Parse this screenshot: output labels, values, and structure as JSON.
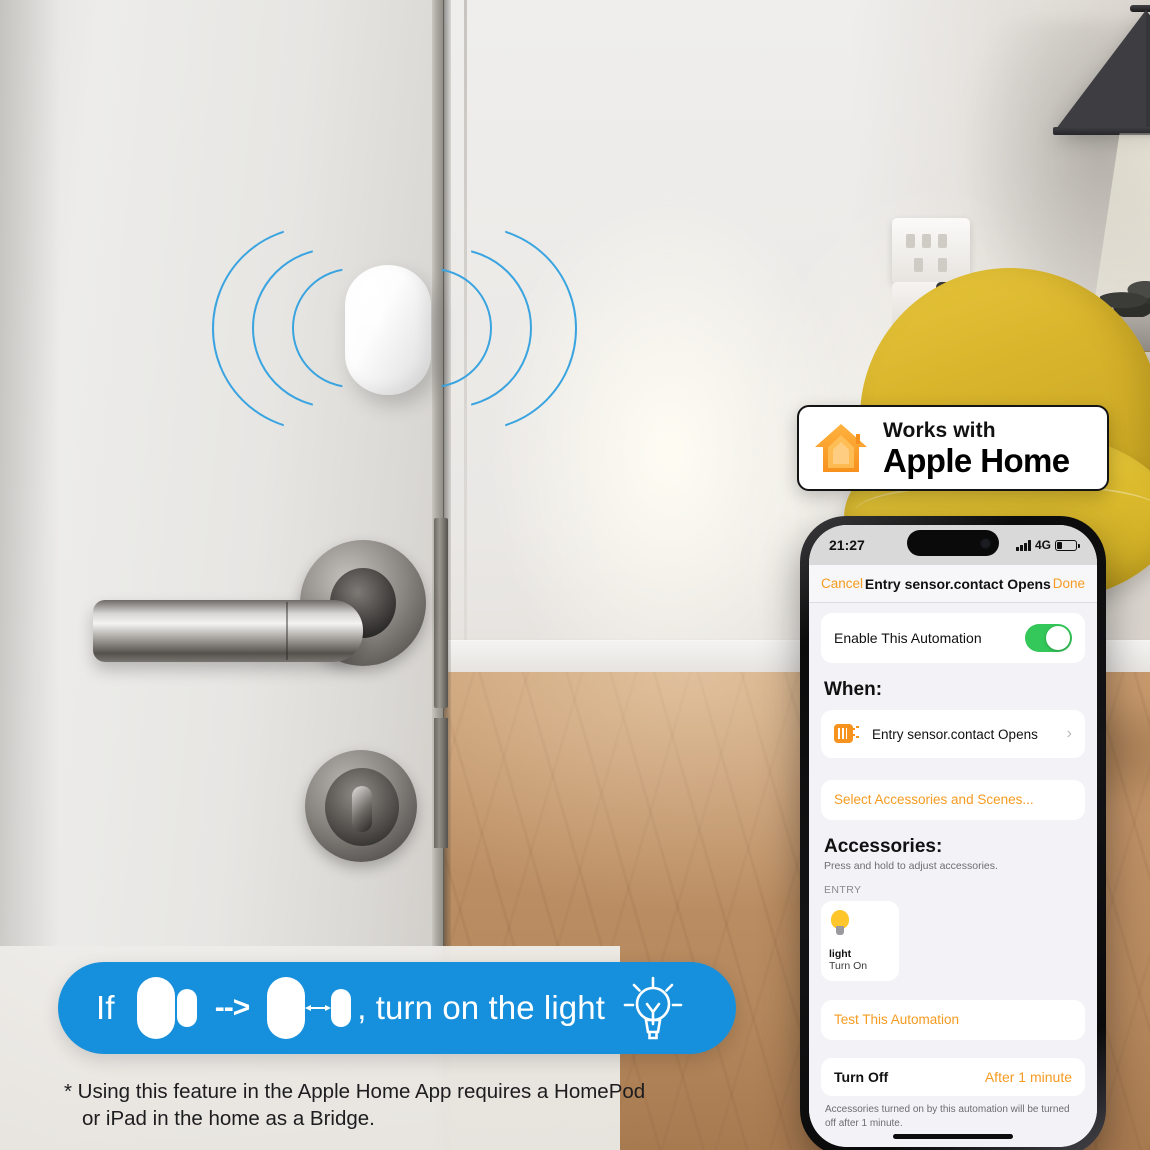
{
  "badge": {
    "icon": "apple-home-house-icon",
    "line1": "Works with",
    "line2": "Apple Home"
  },
  "phone": {
    "status_bar": {
      "time": "21:27",
      "signal_icon": "cellular-bars-icon",
      "network": "4G",
      "battery_icon": "battery-icon"
    },
    "nav": {
      "cancel": "Cancel",
      "title": "Entry sensor.contact Opens",
      "done": "Done"
    },
    "enable_row": {
      "label": "Enable This Automation",
      "toggle_state": "on",
      "toggle_color": "#34C759"
    },
    "when": {
      "heading": "When:",
      "trigger_icon": "contact-sensor-icon",
      "trigger_label": "Entry sensor.contact Opens",
      "chevron": "›"
    },
    "select_accessories_link": "Select Accessories and Scenes...",
    "accessories": {
      "heading": "Accessories:",
      "hint": "Press and hold to adjust accessories.",
      "group": "ENTRY",
      "tiles": [
        {
          "icon": "light-bulb-icon",
          "name": "light",
          "state": "Turn On"
        }
      ]
    },
    "test_link": "Test This Automation",
    "turn_off": {
      "label": "Turn Off",
      "value": "After 1 minute"
    },
    "footer_note": "Accessories turned on by this automation will be turned off after 1 minute.",
    "accent_color": "#F59B21"
  },
  "banner": {
    "if_label": "If",
    "closed_sensor_icon": "contact-sensor-closed-icon",
    "arrow": "-->",
    "open_sensor_icon": "contact-sensor-open-icon",
    "text": ", turn on the light",
    "bulb_icon": "light-bulb-outline-icon",
    "background_color": "#1690DC"
  },
  "footnote": {
    "line1": "* Using this feature in the Apple Home App requires a HomePod",
    "line2": "or iPad in the home as a Bridge."
  },
  "scene": {
    "door_sensor_icon": "wireless-contact-sensor",
    "door_handle_icon": "door-lever-handle",
    "door_lock_icon": "thumb-turn-lock",
    "lamp_icon": "cone-floor-lamp",
    "chair_icon": "yellow-armchair",
    "table_icon": "round-side-table",
    "socket_icon": "wall-power-socket"
  }
}
